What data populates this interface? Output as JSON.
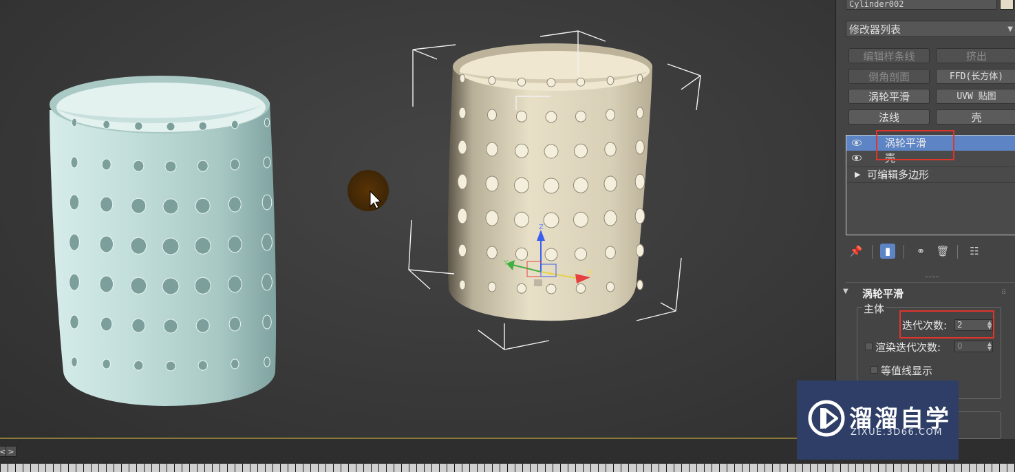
{
  "object_name": "Cylinder002",
  "modifier_list": {
    "label": "修改器列表"
  },
  "modifier_buttons": [
    {
      "label": "编辑样条线",
      "enabled": false
    },
    {
      "label": "挤出",
      "enabled": false
    },
    {
      "label": "倒角剖面",
      "enabled": false
    },
    {
      "label": "FFD(长方体)",
      "enabled": true
    },
    {
      "label": "涡轮平滑",
      "enabled": true
    },
    {
      "label": "UVW 贴图",
      "enabled": true
    },
    {
      "label": "法线",
      "enabled": true
    },
    {
      "label": "壳",
      "enabled": true
    }
  ],
  "stack": {
    "items": [
      {
        "label": "涡轮平滑",
        "selected": true,
        "visible": true
      },
      {
        "label": "壳",
        "selected": false,
        "visible": true
      },
      {
        "label": "可编辑多边形",
        "selected": false,
        "expandable": true
      }
    ]
  },
  "rollout": {
    "title": "涡轮平滑",
    "group_title": "主体",
    "iterations": {
      "label": "迭代次数:",
      "value": "2"
    },
    "render_iterations": {
      "label": "渲染迭代次数:",
      "value": "0",
      "checked": false
    },
    "isoline_display": {
      "label": "等值线显示",
      "checked": false
    }
  },
  "watermark": {
    "title": "溜溜自学",
    "url": "ZIXUE.3D66.COM"
  },
  "colors": {
    "selection": "#5d85c6",
    "highlight_box": "#e0352b",
    "left_cup": "#b9d6d2",
    "right_cup": "#ddd4bd",
    "swatch": "#e4dcc6"
  }
}
